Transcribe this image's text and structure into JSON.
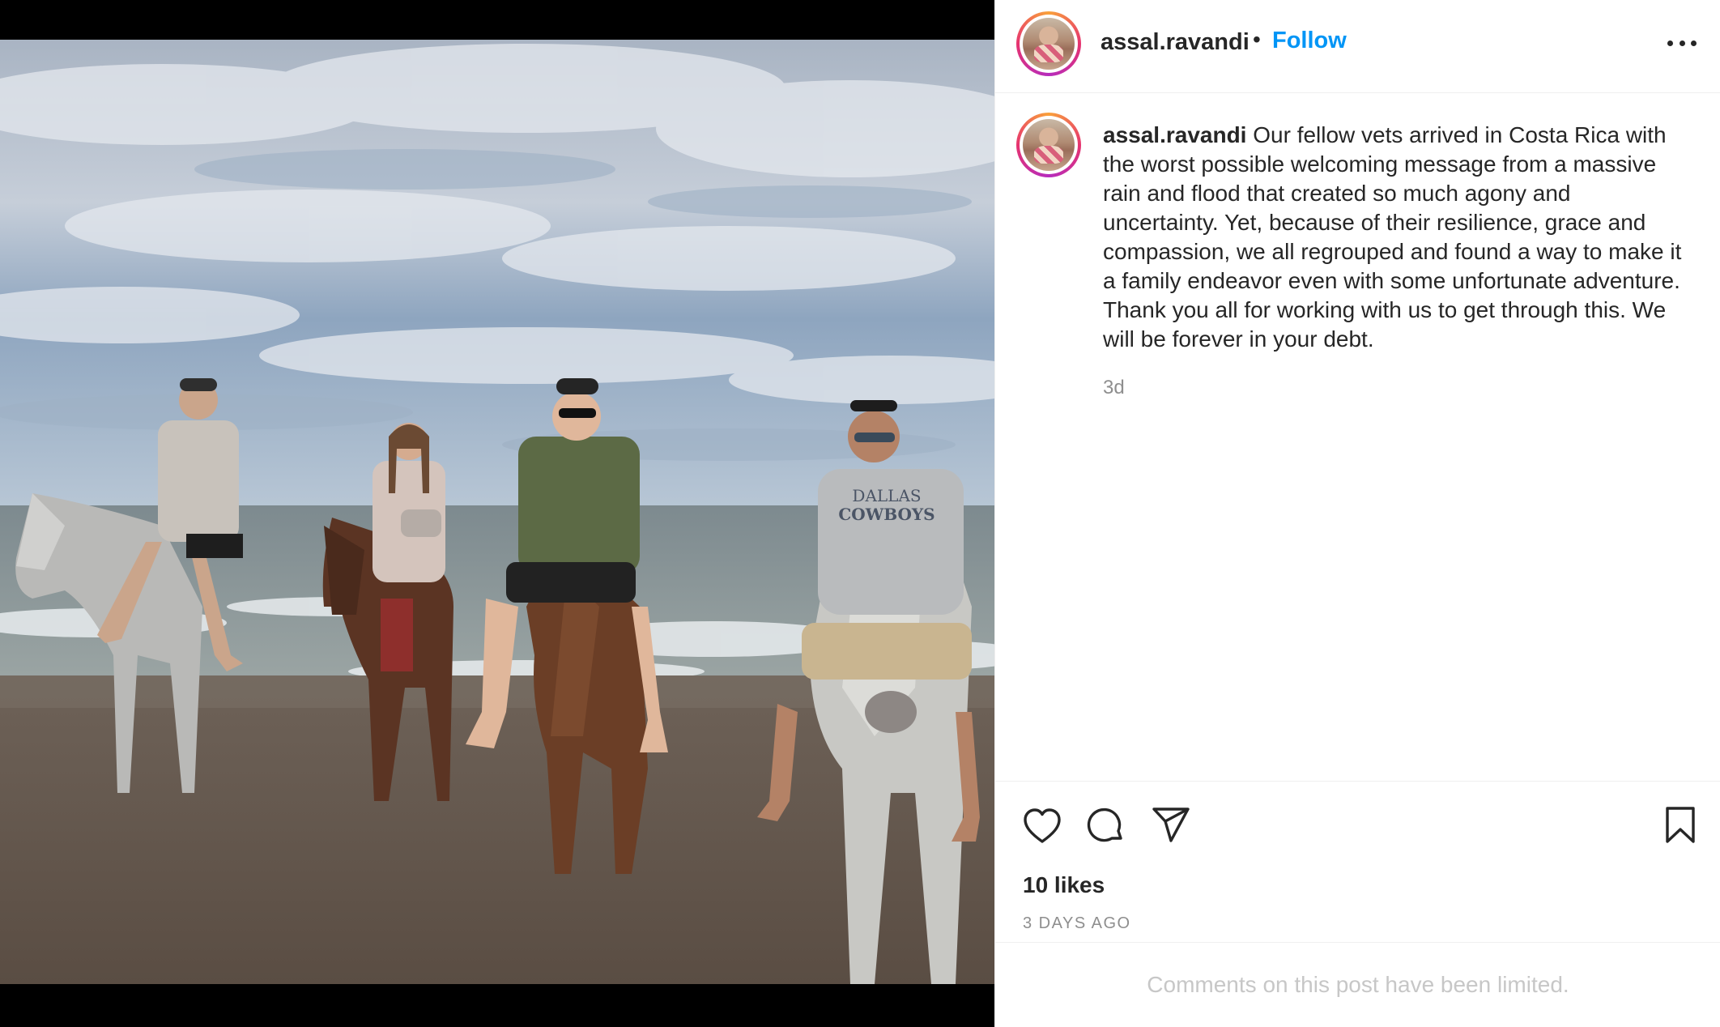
{
  "post": {
    "username": "assal.ravandi",
    "follow_label": "Follow",
    "separator": "•",
    "caption_username": "assal.ravandi",
    "caption_text": "Our fellow vets arrived in Costa Rica with the worst possible welcoming message from a massive rain and flood that created so much agony and uncertainty. Yet, because of their resilience, grace and compassion, we all regrouped and found a way to make it a family endeavor even with some unfortunate adventure. Thank you all for working with us to get through this. We will be forever in your debt.",
    "caption_time": "3d",
    "likes": "10 likes",
    "date": "3 DAYS AGO",
    "comments_note": "Comments on this post have been limited."
  },
  "photo_text": {
    "shirt_line1": "DALLAS",
    "shirt_line2": "COWBOYS"
  },
  "icons": {
    "like": "heart-icon",
    "comment": "comment-bubble-icon",
    "share": "paper-plane-icon",
    "save": "bookmark-icon",
    "more": "more-options-icon"
  },
  "colors": {
    "accent": "#0095f6",
    "text": "#262626",
    "muted": "#8e8e8e",
    "divider": "#efefef"
  }
}
